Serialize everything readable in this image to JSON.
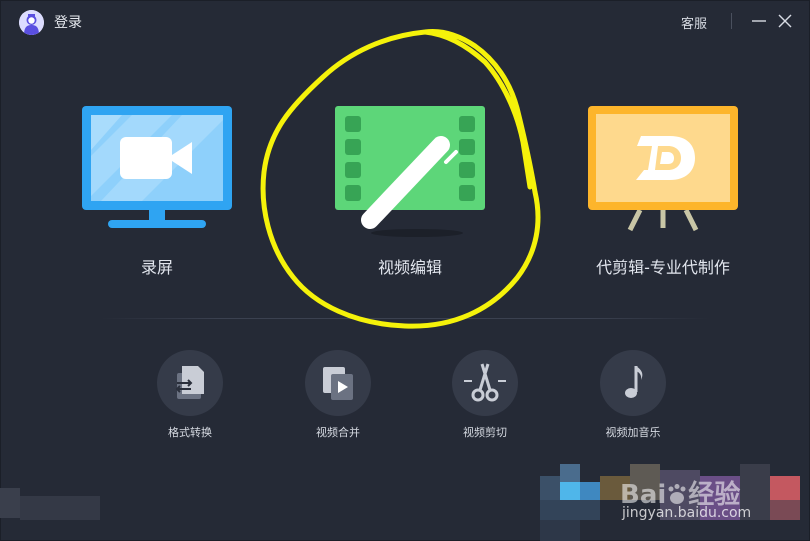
{
  "titlebar": {
    "login_label": "登录",
    "service_label": "客服",
    "minimize_icon": "minimize-icon",
    "close_icon": "close-icon"
  },
  "features": [
    {
      "label": "录屏",
      "icon": "screen-record-icon",
      "color": "#2fa4f2"
    },
    {
      "label": "视频编辑",
      "icon": "video-edit-icon",
      "color": "#5dd679"
    },
    {
      "label": "代剪辑-专业代制作",
      "icon": "proxy-edit-icon",
      "color": "#fdb52b"
    }
  ],
  "tools": [
    {
      "label": "格式转换",
      "icon": "format-convert-icon"
    },
    {
      "label": "视频合并",
      "icon": "video-merge-icon"
    },
    {
      "label": "视频剪切",
      "icon": "scissors-icon"
    },
    {
      "label": "视频加音乐",
      "icon": "music-note-icon"
    }
  ],
  "annotation_color": "#f5f20a",
  "watermark": {
    "logo": "Bai",
    "logo_suffix": "经验",
    "url": "jingyan.baidu.com"
  }
}
